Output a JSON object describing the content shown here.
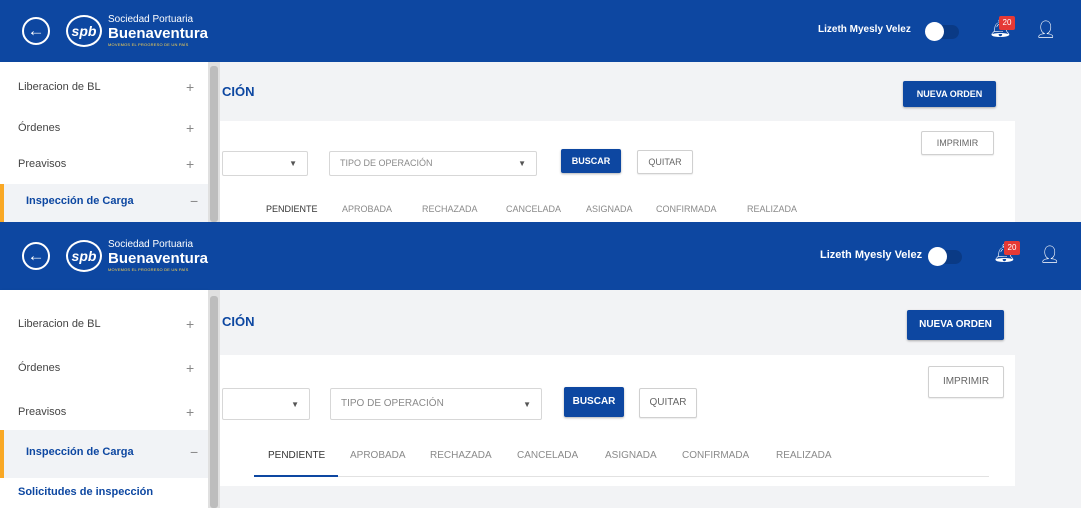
{
  "header": {
    "back_icon": "arrow-left-icon",
    "logo": {
      "mark": "spb",
      "line1": "Sociedad Portuaria",
      "line2": "Buenaventura",
      "line3": "MOVEMOS EL PROGRESO DE UN PAÍS"
    },
    "user_name": "Lizeth Myesly Velez",
    "toggle_on": false,
    "notifications_icon": "bell-icon",
    "notifications_count": "20",
    "profile_icon": "person-icon",
    "color": "#0d47a1"
  },
  "sidebar": {
    "items": [
      {
        "label": "Liberacion de BL",
        "toggle": "+"
      },
      {
        "label": "Órdenes",
        "toggle": "+"
      },
      {
        "label": "Preavisos",
        "toggle": "+"
      },
      {
        "label": "Inspección de Carga",
        "toggle": "−"
      }
    ],
    "sub_items": [
      "Solicitudes de inspección"
    ],
    "active_color": "#f9a825"
  },
  "page": {
    "title": "CIÓN",
    "new_order_label": "NUEVA ORDEN",
    "print_label": "IMPRIMIR",
    "filter_select_placeholder": "",
    "operation_type_placeholder": "TIPO DE OPERACIÓN",
    "search_label": "BUSCAR",
    "clear_label": "QUITAR",
    "tabs": [
      "PENDIENTE",
      "APROBADA",
      "RECHAZADA",
      "CANCELADA",
      "ASIGNADA",
      "CONFIRMADA",
      "REALIZADA"
    ],
    "active_tab": "PENDIENTE"
  }
}
